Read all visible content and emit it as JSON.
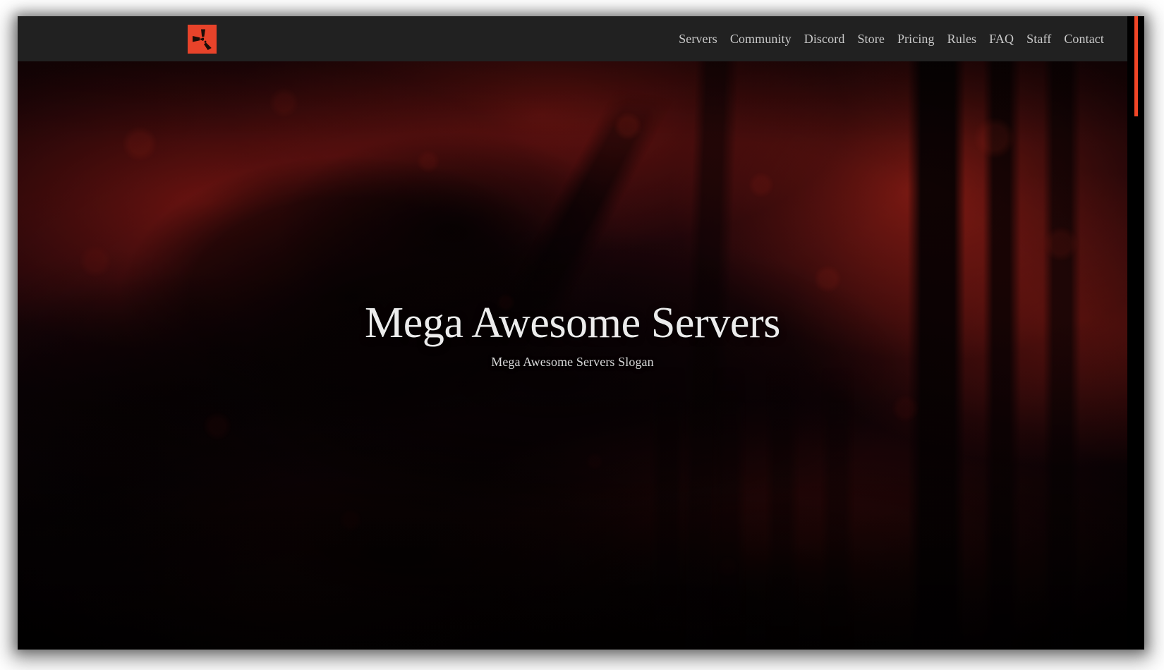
{
  "site": {
    "brand": {
      "logo_icon": "pinwheel-blades-icon",
      "logo_bg_color": "#e8432a",
      "logo_fg_color": "#1a0d08"
    },
    "header": {
      "bg_color": "#212121",
      "nav_items": [
        {
          "label": "Servers"
        },
        {
          "label": "Community"
        },
        {
          "label": "Discord"
        },
        {
          "label": "Store"
        },
        {
          "label": "Pricing"
        },
        {
          "label": "Rules"
        },
        {
          "label": "FAQ"
        },
        {
          "label": "Staff"
        },
        {
          "label": "Contact"
        }
      ],
      "nav_text_color": "#c9c9c9"
    },
    "hero": {
      "title": "Mega Awesome Servers",
      "subtitle": "Mega Awesome Servers Slogan",
      "title_color": "#ececec",
      "subtitle_color": "#d9d9d9",
      "background_description": "dark red duotone photograph of a soldier aiming a rifle through foliage beside a wooden fence"
    },
    "scrollbar": {
      "thumb_color": "#f04627",
      "track_color": "#000000"
    }
  }
}
